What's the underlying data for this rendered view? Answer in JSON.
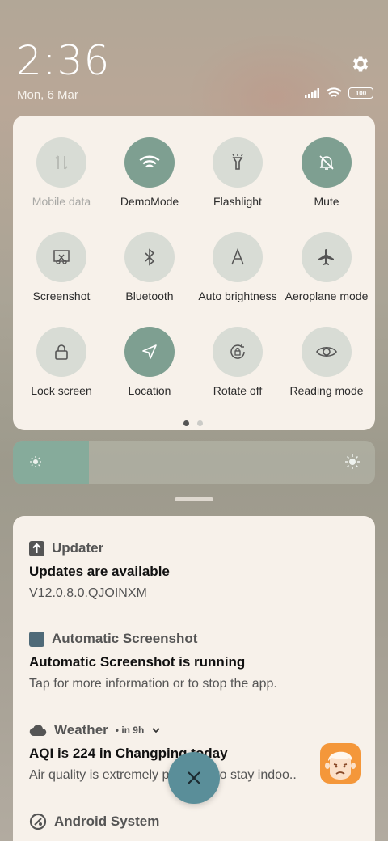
{
  "status": {
    "time": "2:36",
    "date": "Mon, 6 Mar",
    "battery": "100",
    "icons": [
      "settings-gear-icon",
      "signal-icon",
      "wifi-icon",
      "battery-icon"
    ]
  },
  "quick_settings": {
    "tiles": [
      {
        "label": "Mobile data",
        "icon": "mobile-data-icon",
        "active": false,
        "disabled": true
      },
      {
        "label": "DemoMode",
        "icon": "wifi-icon",
        "active": true
      },
      {
        "label": "Flashlight",
        "icon": "flashlight-icon",
        "active": false
      },
      {
        "label": "Mute",
        "icon": "bell-off-icon",
        "active": true
      },
      {
        "label": "Screenshot",
        "icon": "screenshot-icon",
        "active": false
      },
      {
        "label": "Bluetooth",
        "icon": "bluetooth-icon",
        "active": false
      },
      {
        "label": "Auto brightness",
        "icon": "auto-brightness-icon",
        "active": false
      },
      {
        "label": "Aeroplane mode",
        "icon": "airplane-icon",
        "active": false
      },
      {
        "label": "Lock screen",
        "icon": "lock-icon",
        "active": false
      },
      {
        "label": "Location",
        "icon": "location-arrow-icon",
        "active": true
      },
      {
        "label": "Rotate off",
        "icon": "rotation-lock-icon",
        "active": false
      },
      {
        "label": "Reading mode",
        "icon": "eye-icon",
        "active": false
      }
    ],
    "page_indicator": {
      "pages": 2,
      "current": 1
    }
  },
  "brightness": {
    "level": 0.21,
    "accent": "#86ab9b"
  },
  "notifications": [
    {
      "app": "Updater",
      "title": "Updates are available",
      "body": "V12.0.8.0.QJOINXM"
    },
    {
      "app": "Automatic Screenshot",
      "title": "Automatic Screenshot is running",
      "body": "Tap for more information or to stop the app."
    },
    {
      "app": "Weather",
      "meta": "in 9h",
      "title": "AQI is 224 in Changping today",
      "body": "Air quality is extremely poor. Try to stay indoo.."
    },
    {
      "app": "Android System"
    }
  ],
  "colors": {
    "active_tile": "#7e9f91",
    "inactive_tile": "#d8dcd5",
    "panel": "#f7f1ea",
    "fab": "#5a8e99"
  }
}
